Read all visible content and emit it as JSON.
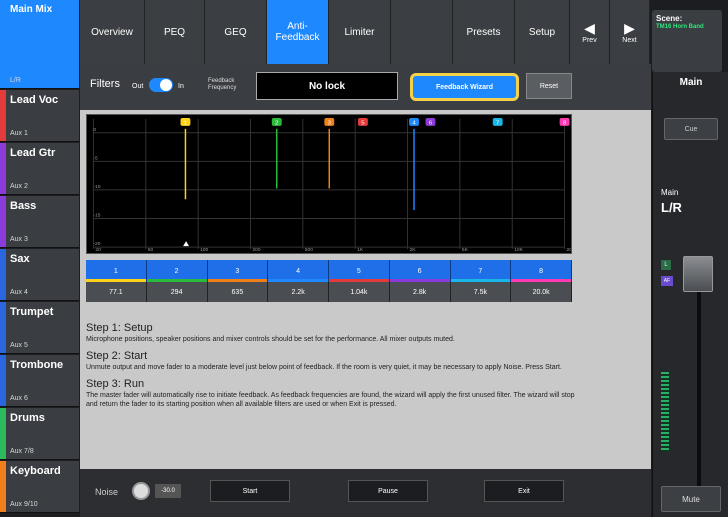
{
  "channels": [
    {
      "name": "Main Mix",
      "sub": "L/R",
      "color": "#1e88ff",
      "active": true
    },
    {
      "name": "Lead Voc",
      "sub": "Aux 1",
      "color": "#e33b3b"
    },
    {
      "name": "Lead Gtr",
      "sub": "Aux 2",
      "color": "#8b3bd9"
    },
    {
      "name": "Bass",
      "sub": "Aux 3",
      "color": "#8b3bd9"
    },
    {
      "name": "Sax",
      "sub": "Aux 4",
      "color": "#2a66e0"
    },
    {
      "name": "Trumpet",
      "sub": "Aux 5",
      "color": "#2a66e0"
    },
    {
      "name": "Trombone",
      "sub": "Aux 6",
      "color": "#2a66e0"
    },
    {
      "name": "Drums",
      "sub": "Aux 7/8",
      "color": "#2bbb5c"
    },
    {
      "name": "Keyboard",
      "sub": "Aux 9/10",
      "color": "#f07e1a"
    }
  ],
  "tabs": [
    {
      "label": "Overview"
    },
    {
      "label": "PEQ"
    },
    {
      "label": "GEQ"
    },
    {
      "label": "Anti-Feedback",
      "active": true
    },
    {
      "label": "Limiter"
    },
    {
      "label": ""
    },
    {
      "label": "Presets"
    },
    {
      "label": "Setup"
    }
  ],
  "nav": {
    "prev": "Prev",
    "next": "Next"
  },
  "scene": {
    "label": "Scene:",
    "name": "TM16 Horn Band"
  },
  "filters": {
    "label": "Filters",
    "out_label": "Out",
    "in_label": "In",
    "feedback_label_1": "Feedback",
    "feedback_label_2": "Frequency",
    "lock_value": "No lock",
    "wizard_label": "Feedback Wizard",
    "reset_label": "Reset"
  },
  "graph": {
    "x_ticks": [
      "20",
      "50",
      "100",
      "200",
      "500",
      "1K",
      "2K",
      "5K",
      "10K",
      "20K"
    ],
    "y_ticks": [
      "0",
      "-5",
      "-10",
      "-15",
      "-20"
    ]
  },
  "filter_list": [
    {
      "num": "1",
      "freq": "77.1",
      "color": "#ffd21a"
    },
    {
      "num": "2",
      "freq": "294",
      "color": "#2bbb3c"
    },
    {
      "num": "3",
      "freq": "635",
      "color": "#f0801a"
    },
    {
      "num": "4",
      "freq": "2.2k",
      "color": "#1e88ff"
    },
    {
      "num": "5",
      "freq": "1.04k",
      "color": "#e33b3b"
    },
    {
      "num": "6",
      "freq": "2.8k",
      "color": "#8b3bd9"
    },
    {
      "num": "7",
      "freq": "7.5k",
      "color": "#19b6e8"
    },
    {
      "num": "8",
      "freq": "20.0k",
      "color": "#ff3ab0"
    }
  ],
  "steps": [
    {
      "title": "Step 1: Setup",
      "body": "Microphone positions, speaker positions and mixer controls should be set for the performance. All mixer outputs muted."
    },
    {
      "title": "Step 2: Start",
      "body": "Unmute output and move fader to a moderate level just below point of feedback. If the room is very quiet, it may be necessary to apply Noise. Press Start."
    },
    {
      "title": "Step 3: Run",
      "body": "The master fader will automatically rise to initiate feedback. As feedback frequencies are found, the wizard will apply the first unused filter. The wizard will stop and return the fader to its starting position when all available filters are used or when Exit is pressed."
    }
  ],
  "bottom": {
    "noise_label": "Noise",
    "noise_value": "-30.0",
    "start": "Start",
    "pause": "Pause",
    "exit": "Exit"
  },
  "right_panel": {
    "title": "Main",
    "cue": "Cue",
    "main_label": "Main",
    "bus": "L/R",
    "mute": "Mute",
    "l": "L",
    "af": "AF"
  }
}
